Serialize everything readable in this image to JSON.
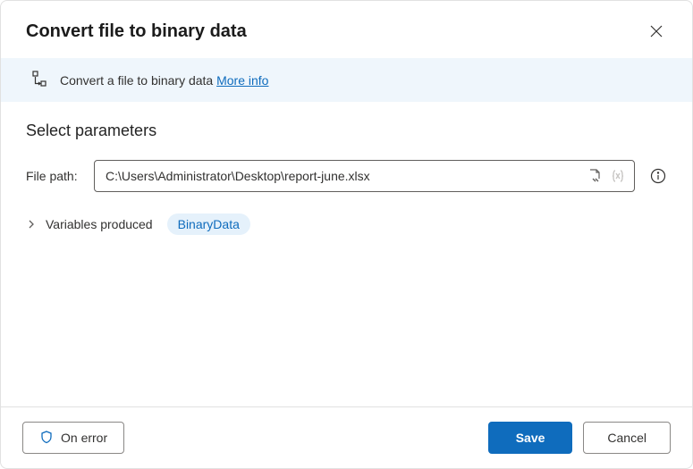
{
  "header": {
    "title": "Convert file to binary data"
  },
  "banner": {
    "text": "Convert a file to binary data ",
    "link": "More info"
  },
  "params": {
    "heading": "Select parameters",
    "file_label": "File path:",
    "file_value": "C:\\Users\\Administrator\\Desktop\\report-june.xlsx"
  },
  "variables": {
    "label": "Variables produced",
    "chip": "BinaryData"
  },
  "footer": {
    "on_error": "On error",
    "save": "Save",
    "cancel": "Cancel"
  }
}
